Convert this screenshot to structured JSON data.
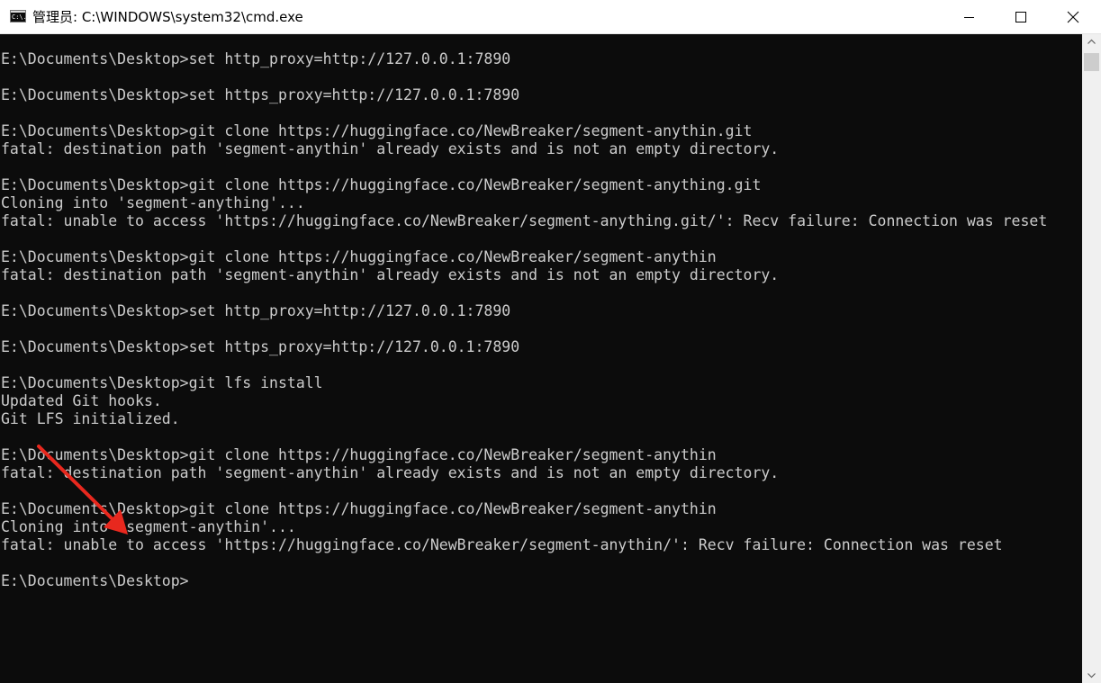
{
  "window": {
    "title": "管理员: C:\\WINDOWS\\system32\\cmd.exe",
    "icon": "cmd-icon",
    "icon_text": "C:\\."
  },
  "caption_buttons": {
    "minimize": "minimize-icon",
    "maximize": "maximize-icon",
    "close": "close-icon"
  },
  "console": {
    "background": "#0c0c0c",
    "foreground": "#cccccc",
    "lines": [
      "E:\\Documents\\Desktop>set http_proxy=http://127.0.0.1:7890",
      "",
      "E:\\Documents\\Desktop>set https_proxy=http://127.0.0.1:7890",
      "",
      "E:\\Documents\\Desktop>git clone https://huggingface.co/NewBreaker/segment-anythin.git",
      "fatal: destination path 'segment-anythin' already exists and is not an empty directory.",
      "",
      "E:\\Documents\\Desktop>git clone https://huggingface.co/NewBreaker/segment-anything.git",
      "Cloning into 'segment-anything'...",
      "fatal: unable to access 'https://huggingface.co/NewBreaker/segment-anything.git/': Recv failure: Connection was reset",
      "",
      "E:\\Documents\\Desktop>git clone https://huggingface.co/NewBreaker/segment-anythin",
      "fatal: destination path 'segment-anythin' already exists and is not an empty directory.",
      "",
      "E:\\Documents\\Desktop>set http_proxy=http://127.0.0.1:7890",
      "",
      "E:\\Documents\\Desktop>set https_proxy=http://127.0.0.1:7890",
      "",
      "E:\\Documents\\Desktop>git lfs install",
      "Updated Git hooks.",
      "Git LFS initialized.",
      "",
      "E:\\Documents\\Desktop>git clone https://huggingface.co/NewBreaker/segment-anythin",
      "fatal: destination path 'segment-anythin' already exists and is not an empty directory.",
      "",
      "E:\\Documents\\Desktop>git clone https://huggingface.co/NewBreaker/segment-anythin",
      "Cloning into 'segment-anythin'...",
      "fatal: unable to access 'https://huggingface.co/NewBreaker/segment-anythin/': Recv failure: Connection was reset",
      "",
      "E:\\Documents\\Desktop>"
    ]
  },
  "annotation": {
    "type": "arrow",
    "color": "#e8281e"
  }
}
